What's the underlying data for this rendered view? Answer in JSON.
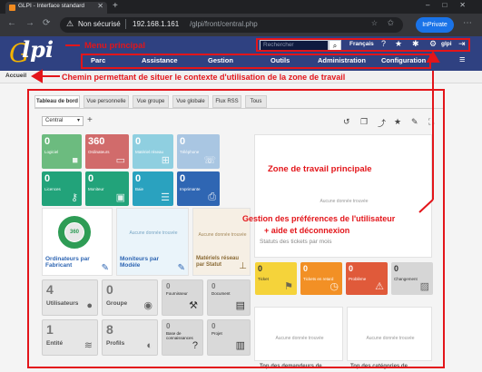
{
  "browser": {
    "tab_title": "GLPI - Interface standard",
    "close_glyph": "✕",
    "new_tab_glyph": "+",
    "window_controls": "–□✕",
    "back_glyph": "←",
    "forward_glyph": "→",
    "reload_glyph": "⟳",
    "security_icon": "warning-icon",
    "security_glyph": "⚠",
    "security_label": "Non sécurisé",
    "url_host": "192.168.1.161",
    "url_path": "/glpi/front/central.php",
    "fav_glyph": "☆",
    "star_glyph": "✩",
    "private_label": "InPrivate",
    "menu_glyph": "⋯"
  },
  "header": {
    "logo_g": "G",
    "logo_text": "lpi",
    "search_placeholder": "Rechercher",
    "search_glyph": "⌕",
    "language": "Français",
    "help_glyph": "?",
    "star_glyph": "★",
    "bug_glyph": "✱",
    "gear_glyph": "⚙",
    "user": "glpi",
    "logout_glyph": "⇥",
    "hamburger_glyph": "≡",
    "menu": [
      "Parc",
      "Assistance",
      "Gestion",
      "Outils",
      "Administration",
      "Configuration"
    ],
    "bg_color": "#2f4181"
  },
  "breadcrumb": {
    "home": "Accueil"
  },
  "tabs": [
    "Tableau de bord",
    "Vue personnelle",
    "Vue groupe",
    "Vue globale",
    "Flux RSS",
    "Tous"
  ],
  "dashboard": {
    "selected": "Central",
    "caret": "▾",
    "add_glyph": "+",
    "toolbar_glyphs": [
      "↺",
      "❐",
      "⤴",
      "★",
      "✎",
      "⛶"
    ]
  },
  "cards_colored": [
    {
      "value": "0",
      "label": "Logiciel",
      "icon": "cube-icon",
      "glyph": "■",
      "color": "#6cbb7f"
    },
    {
      "value": "360",
      "label": "Ordinateurs",
      "icon": "laptop-icon",
      "glyph": "▭",
      "color": "#d16b6b"
    },
    {
      "value": "0",
      "label": "Matériel réseau",
      "icon": "network-icon",
      "glyph": "⊞",
      "color": "#8fcfe0"
    },
    {
      "value": "0",
      "label": "Téléphone",
      "icon": "phone-icon",
      "glyph": "☏",
      "color": "#a9c6e2"
    },
    {
      "value": "0",
      "label": "Licences",
      "icon": "key-icon",
      "glyph": "⚷",
      "color": "#22a37a"
    },
    {
      "value": "0",
      "label": "Moniteur",
      "icon": "monitor-icon",
      "glyph": "▣",
      "color": "#22a37a"
    },
    {
      "value": "0",
      "label": "Baie",
      "icon": "server-icon",
      "glyph": "☰",
      "color": "#2aa2bf"
    },
    {
      "value": "0",
      "label": "Imprimante",
      "icon": "printer-icon",
      "glyph": "⎙",
      "color": "#2f66b3"
    }
  ],
  "widgets_mid": {
    "donut_center": "360",
    "donut_color": "#2e9c55",
    "donut_label": "Ordinateurs par Fabricant",
    "no_data": "Aucune donnée trouvée",
    "monitors_label": "Moniteurs par Modèle",
    "network_label": "Matériels réseau par Statut",
    "edit_glyph": "✎",
    "tree_glyph": "⊥"
  },
  "cards_gray": [
    {
      "value": "4",
      "label": "Utilisateurs",
      "icon": "user-icon",
      "glyph": "●"
    },
    {
      "value": "0",
      "label": "Groupe",
      "icon": "group-icon",
      "glyph": "◉"
    },
    {
      "value": "0",
      "label": "Fournisseur",
      "icon": "supplier-icon",
      "glyph": "⚒"
    },
    {
      "value": "0",
      "label": "Document",
      "icon": "document-icon",
      "glyph": "▤"
    },
    {
      "value": "1",
      "label": "Entité",
      "icon": "layers-icon",
      "glyph": "≋"
    },
    {
      "value": "8",
      "label": "Profils",
      "icon": "profile-icon",
      "glyph": "◐"
    },
    {
      "value": "0",
      "label": "Base de connaissances",
      "icon": "question-icon",
      "glyph": "?"
    },
    {
      "value": "0",
      "label": "Projet",
      "icon": "columns-icon",
      "glyph": "▥"
    }
  ],
  "right_panel": {
    "no_data_1": "Aucune donnée trouvée",
    "stats_label": "Statuts des tickets par mois",
    "tickets": [
      {
        "value": "0",
        "label": "Ticket",
        "color": "#f5d33a",
        "icon": "flag-icon",
        "glyph": "⚑"
      },
      {
        "value": "0",
        "label": "Tickets en retard",
        "color": "#f29025",
        "icon": "clock-icon",
        "glyph": "◷"
      },
      {
        "value": "0",
        "label": "Problème",
        "color": "#e05a3a",
        "icon": "alert-icon",
        "glyph": "⚠"
      },
      {
        "value": "0",
        "label": "Changement",
        "color": "#d6d6d6",
        "icon": "clipboard-icon",
        "glyph": "▨"
      }
    ],
    "no_data_2": "Aucune donnée trouvée",
    "no_data_3": "Aucune donnée trouvée",
    "bottom_left": "Top des demandeurs de",
    "bottom_right": "Top des catégories de"
  },
  "annotations": {
    "menu_principal": "Menu principal",
    "chemin": "Chemin permettant de situer le contexte d'utilisation de la zone de travail",
    "zone_travail": "Zone de travail principale",
    "prefs_line1": "Gestion des préférences de l'utilisateur",
    "prefs_line2": "+ aide et déconnexion",
    "color": "#e3151a"
  }
}
